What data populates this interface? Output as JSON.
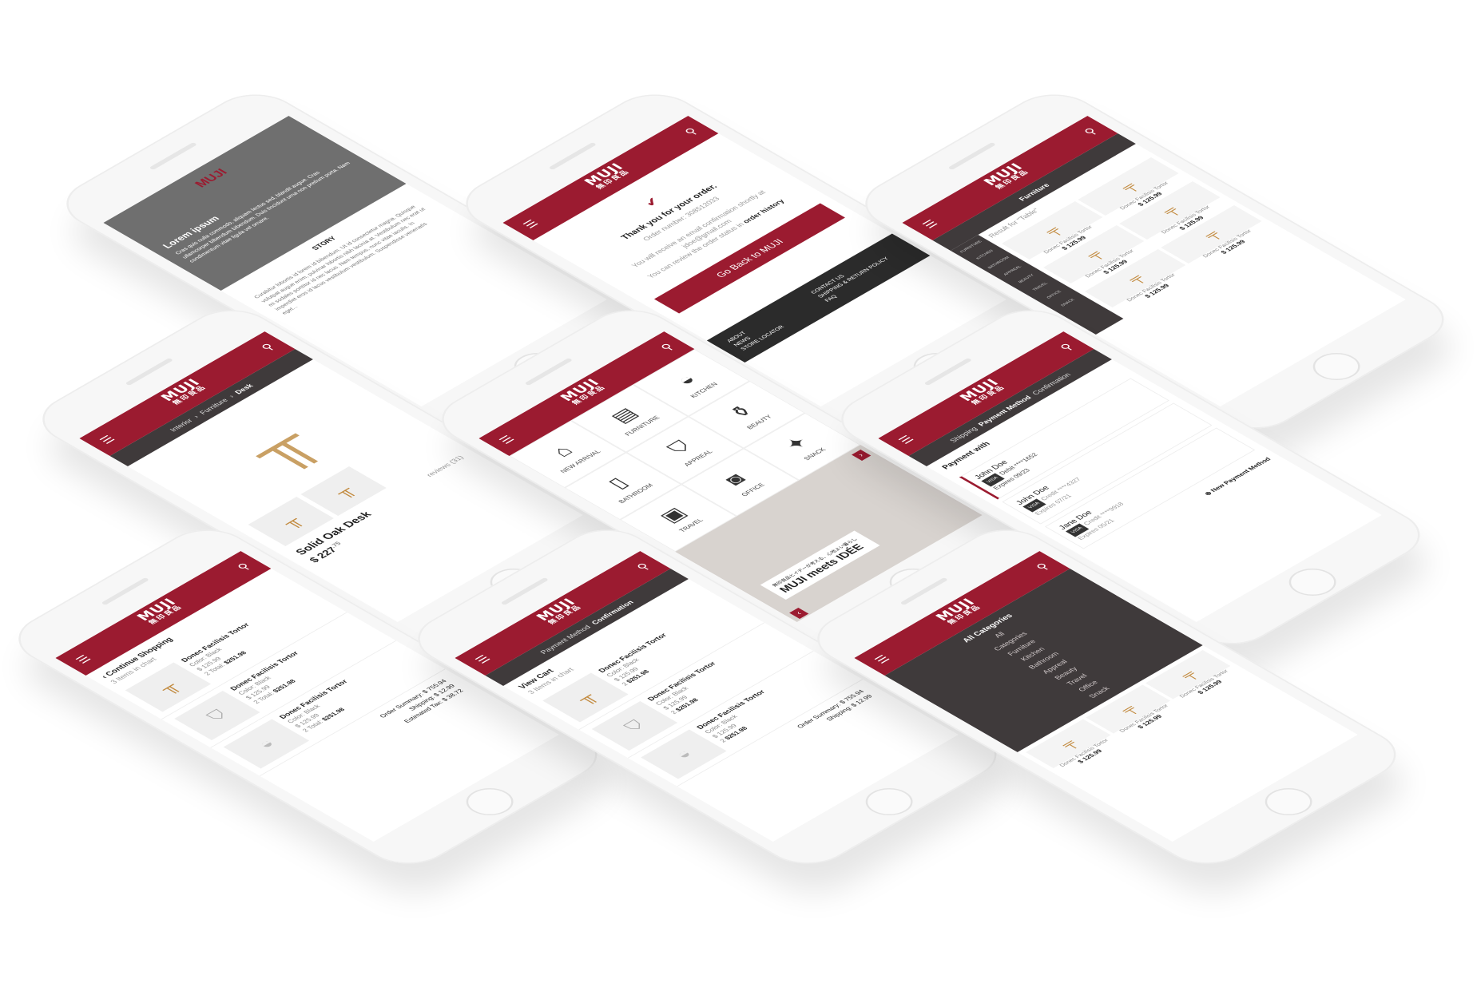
{
  "brand": {
    "name": "MUJI",
    "kanji": "無印良品",
    "accent": "#9b1b30",
    "dark": "#3f3a3b"
  },
  "icons": {
    "menu": "hamburger-icon",
    "search": "search-icon"
  },
  "story_screen": {
    "hero_title": "Lorem ipsum",
    "hero_text": "Cras quis nulla commodo, aliquam lectus sed, blandit augue. Cras ullamcorper bibendum bibendum. Duis tincidunt urna non pretium porta. Nam condimentum vitae ligula vel ornare.",
    "section_label": "STORY",
    "body_text": "Curabitur lobortis id lorem id bibendum. Ut id consectetur magna. Quisque volutpat augue enim, pulvinar lobortis nibh lacinia at. Vestibulum nec erat ut mi sodales porttitor id nec lacus. Nam tempus, nunc vitae iaculis. In imperdiet eros id lacus vestibulum vestibulum. Suspendisse venenatis eget..."
  },
  "confirmation_screen": {
    "thanks": "Thank you for your order.",
    "order_label": "Order number: 308512033",
    "email_note": "You will receive an email confirmation shortly at jdoe@gmail.com",
    "history_note": "You can review the order status in",
    "history_link": "order history",
    "cta": "Go Back to MUJI",
    "footer": [
      "ABOUT",
      "CONTACT US",
      "NEWS",
      "SHIPPING & RETURN POLICY",
      "STORE LOCATOR",
      "FAQ"
    ]
  },
  "furniture_screen": {
    "subbar_title": "Furniture",
    "result_label": "Result for \"Table\"",
    "rail": [
      "FURNITURE",
      "KITCHEN",
      "BATHROOM",
      "APPREAL",
      "BEAUTY",
      "TRAVEL",
      "OFFICE",
      "SNACK"
    ],
    "products": [
      {
        "name": "Donec Facilisis Tortor",
        "price": "$ 125.99"
      },
      {
        "name": "Donec Facilisis Tortor",
        "price": "$ 125.99"
      },
      {
        "name": "Donec Facilisis Tortor",
        "price": "$ 125.99"
      },
      {
        "name": "Donec Facilisis Tortor",
        "price": "$ 125.99"
      },
      {
        "name": "Donec Facilisis Tortor",
        "price": "$ 125.99"
      },
      {
        "name": "Donec Facilisis Tortor",
        "price": "$ 125.99"
      }
    ]
  },
  "product_screen": {
    "breadcrumb": [
      "Interior",
      "Furniture",
      "Desk"
    ],
    "name": "Solid Oak Desk",
    "price_main": "$ 227",
    "price_cents": ".75",
    "reviews": "reviews (31)"
  },
  "home_screen": {
    "categories": [
      "NEW ARRIVAL",
      "FURNITURE",
      "KITCHEN",
      "BATHROOM",
      "APPREAL",
      "BEAUTY",
      "TRAVEL",
      "OFFICE",
      "SNACK"
    ],
    "banner_jp": "無印良品とイデーが考える、心地よい暮らし",
    "banner_title": "MUJI meets IDÉE"
  },
  "payment_screen": {
    "steps": [
      "Shipping",
      "Payment Method",
      "Confirmation"
    ],
    "heading": "Payment with",
    "cards": [
      {
        "name": "John Doe",
        "type": "Debit ****1652",
        "exp": "Expires 09/23"
      },
      {
        "name": "John Doe",
        "type": "Credit ****4327",
        "exp": "Expires 07/21"
      },
      {
        "name": "Jane Doe",
        "type": "Credit ****9918",
        "exp": "Expires 05/21"
      }
    ],
    "new_method": "New Payment Method"
  },
  "cart_screen": {
    "back": "Continue Shopping",
    "count_note": "3 Items in chart",
    "items": [
      {
        "name": "Donec Facilisis Tortor",
        "color": "Color: Black",
        "unit": "$ 125.99",
        "qty": "2",
        "total_label": "Total:",
        "total": "$251.98"
      },
      {
        "name": "Donec Facilisis Tortor",
        "color": "Color: Black",
        "unit": "$ 125.99",
        "qty": "2",
        "total_label": "Total:",
        "total": "$251.98"
      },
      {
        "name": "Donec Facilisis Tortor",
        "color": "Color: Black",
        "unit": "$ 125.99",
        "qty": "2",
        "total_label": "Total:",
        "total": "$251.98"
      }
    ],
    "summary": [
      {
        "label": "Order Summary:",
        "value": "$ 755.94"
      },
      {
        "label": "Shipping:",
        "value": "$ 12.99"
      },
      {
        "label": "Estimated Tax:",
        "value": "$ 38.72"
      }
    ]
  },
  "review_screen": {
    "subbar_title": "Confirmation",
    "step_prev": "Payment Method",
    "heading": "View Cart",
    "count_note": "3 Items in chart",
    "summary": [
      {
        "label": "Order Summary:",
        "value": "$ 755.94"
      },
      {
        "label": "Shipping:",
        "value": "$ 12.99"
      }
    ]
  },
  "categories_screen": {
    "head": "All Categories",
    "items": [
      "All",
      "Categories",
      "Furniture",
      "Kitchen",
      "Bathroom",
      "Appreal",
      "Beauty",
      "Travel",
      "Office",
      "Snack"
    ],
    "product_name": "Donec Facilisis Tortor",
    "price": "$ 125.99"
  }
}
